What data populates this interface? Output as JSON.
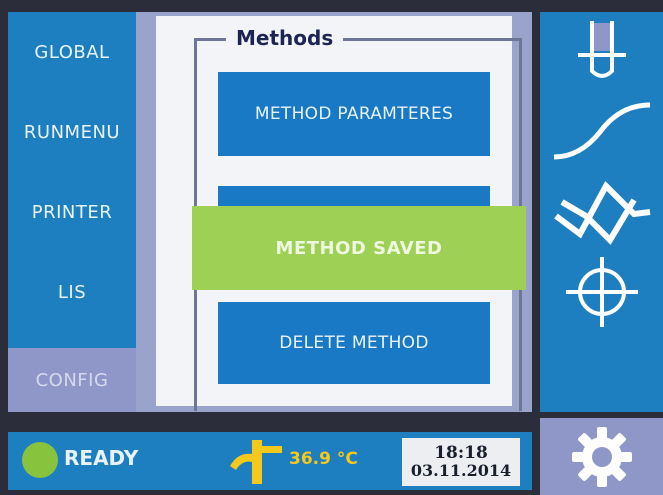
{
  "left_nav": {
    "items": [
      {
        "label": "GLOBAL"
      },
      {
        "label": "RUNMENU"
      },
      {
        "label": "PRINTER"
      },
      {
        "label": "LIS"
      },
      {
        "label": "CONFIG"
      }
    ]
  },
  "methods": {
    "title": "Methods",
    "buttons": [
      {
        "label": "METHOD PARAMTERES"
      },
      {
        "label": ""
      },
      {
        "label": "DELETE METHOD"
      }
    ],
    "toast": "METHOD SAVED"
  },
  "right_rail": {
    "icons": [
      "test-tube-icon",
      "sigmoid-curve-icon",
      "star-graph-icon",
      "crosshair-icon",
      "gear-icon"
    ]
  },
  "status": {
    "state": "READY",
    "temperature": "36.9 °C",
    "time": "18:18",
    "date": "03.11.2014"
  },
  "colors": {
    "panel_blue": "#1e7fc0",
    "button_blue": "#1979c4",
    "toast_green": "#9ed056",
    "selected_lilac": "#8f96c8",
    "temp_yellow": "#f5c81c"
  }
}
